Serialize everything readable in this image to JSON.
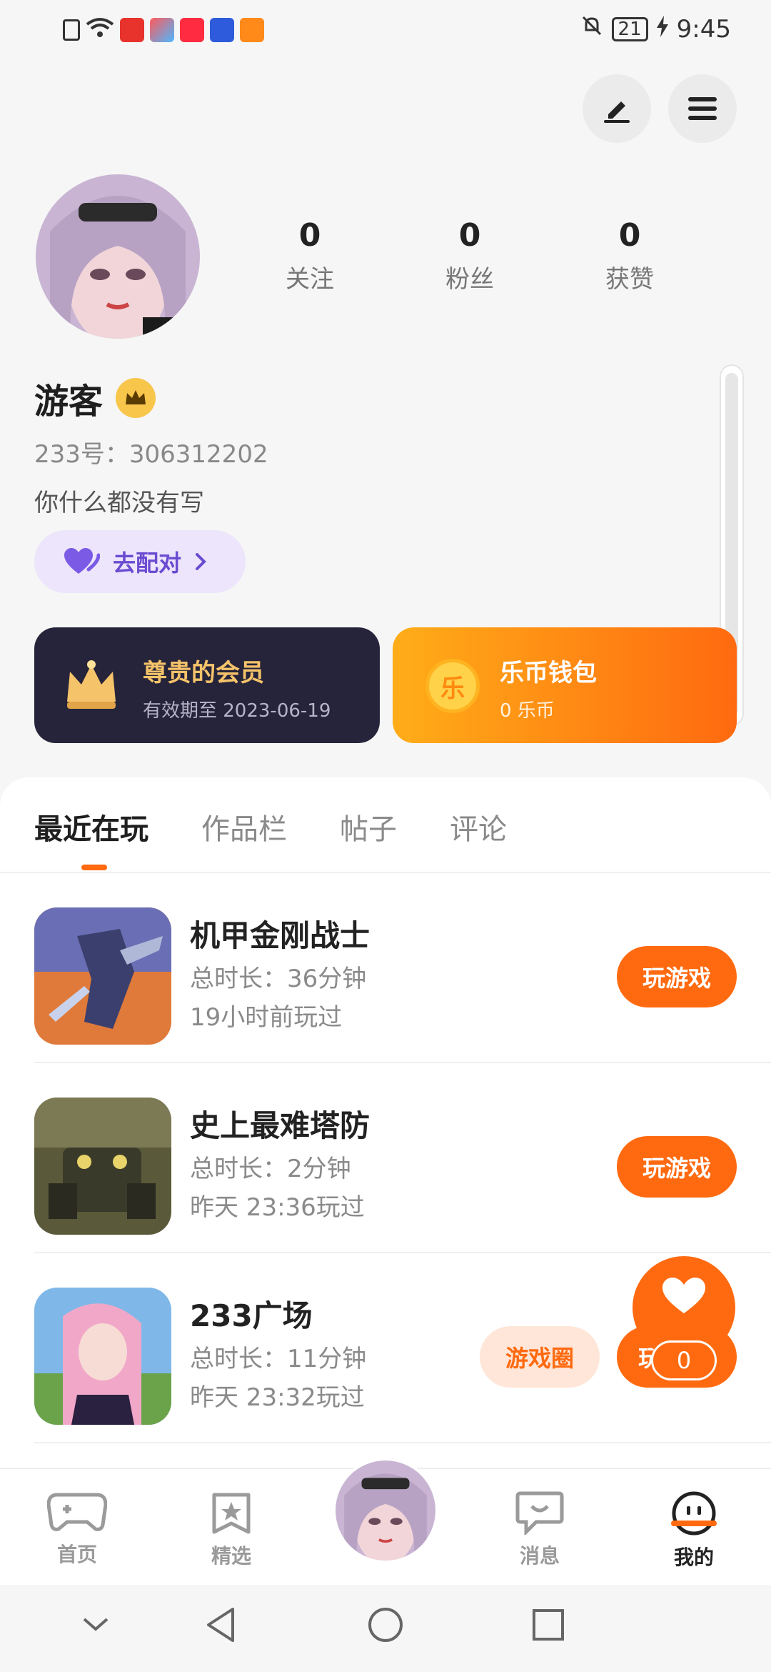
{
  "status_bar": {
    "time": "9:45",
    "battery": "21"
  },
  "header": {
    "edit_icon": "pencil-icon",
    "menu_icon": "hamburger-icon"
  },
  "profile": {
    "name": "游客",
    "uid": "233号：306312202",
    "bio": "你什么都没有写",
    "match_label": "去配对",
    "stats": [
      {
        "value": "0",
        "label": "关注"
      },
      {
        "value": "0",
        "label": "粉丝"
      },
      {
        "value": "0",
        "label": "获赞"
      }
    ]
  },
  "cards": {
    "vip": {
      "title": "尊贵的会员",
      "subtitle": "有效期至 2023-06-19"
    },
    "wallet": {
      "title": "乐币钱包",
      "subtitle": "0 乐币",
      "coin_char": "乐"
    }
  },
  "tabs": [
    {
      "label": "最近在玩",
      "active": true
    },
    {
      "label": "作品栏",
      "active": false
    },
    {
      "label": "帖子",
      "active": false
    },
    {
      "label": "评论",
      "active": false
    }
  ],
  "games": [
    {
      "name": "机甲金刚战士",
      "duration": "总时长：36分钟",
      "last_played": "19小时前玩过",
      "play_label": "玩游戏"
    },
    {
      "name": "史上最难塔防",
      "duration": "总时长：2分钟",
      "last_played": "昨天 23:36玩过",
      "play_label": "玩游戏"
    },
    {
      "name": "233广场",
      "duration": "总时长：11分钟",
      "last_played": "昨天 23:32玩过",
      "play_label": "玩",
      "circle_label": "游戏圈"
    }
  ],
  "like_fab": {
    "count": "0"
  },
  "bottom_nav": [
    {
      "label": "首页"
    },
    {
      "label": "精选"
    },
    {
      "label": "消息"
    },
    {
      "label": "我的"
    }
  ],
  "colors": {
    "accent": "#ff6a10",
    "vip_bg": "#26243a",
    "match_bg": "#ece5fb"
  }
}
